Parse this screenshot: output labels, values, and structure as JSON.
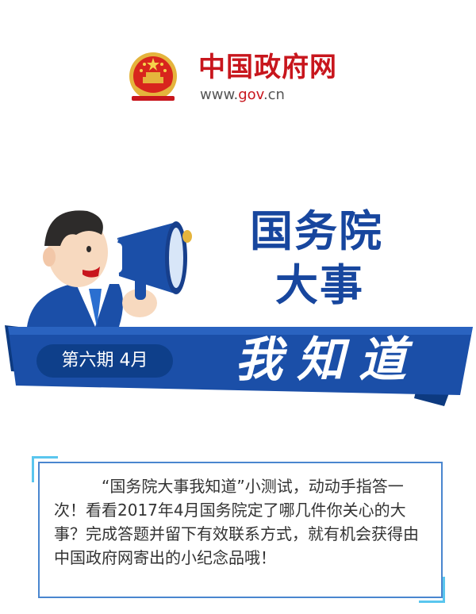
{
  "header": {
    "site_name": "中国政府网",
    "site_url_prefix": "www.",
    "site_url_accent": "gov",
    "site_url_suffix": ".cn",
    "emblem_icon": "national-emblem-icon"
  },
  "title": {
    "line1": "国务院",
    "line2": "大事"
  },
  "banner": {
    "issue": "第六期  4月",
    "slogan": "我知道"
  },
  "intro": {
    "text": "“国务院大事我知道”小测试，动动手指答一次！看看2017年4月国务院定了哪几件你关心的大事？完成答题并留下有效联系方式，就有机会获得由中国政府网寄出的小纪念品哦！"
  },
  "colors": {
    "brand_red": "#c8161d",
    "title_blue": "#17469e",
    "banner_blue": "#1b4fa8",
    "card_border": "#4a86cf",
    "corner_accent": "#5ac6ee"
  }
}
